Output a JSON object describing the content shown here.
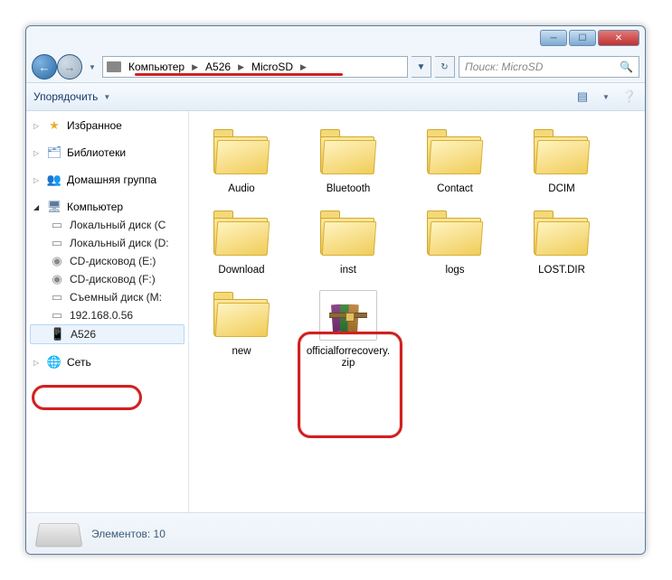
{
  "breadcrumb": {
    "p1": "Компьютер",
    "p2": "A526",
    "p3": "MicroSD"
  },
  "search": {
    "placeholder": "Поиск: MicroSD"
  },
  "toolbar": {
    "organize": "Упорядочить"
  },
  "sidebar": {
    "favorites": "Избранное",
    "libraries": "Библиотеки",
    "homegroup": "Домашняя группа",
    "computer": "Компьютер",
    "drives": {
      "d0": "Локальный диск (C",
      "d1": "Локальный диск (D:",
      "d2": "CD-дисковод (E:)",
      "d3": "CD-дисковод (F:)",
      "d4": "Съемный диск (M:",
      "d5": "192.168.0.56",
      "d6": "A526"
    },
    "network": "Сеть"
  },
  "items": {
    "i0": "Audio",
    "i1": "Bluetooth",
    "i2": "Contact",
    "i3": "DCIM",
    "i4": "Download",
    "i5": "inst",
    "i6": "logs",
    "i7": "LOST.DIR",
    "i8": "new",
    "i9": "officialforrecovery.zip"
  },
  "status": {
    "count_label": "Элементов: 10"
  }
}
